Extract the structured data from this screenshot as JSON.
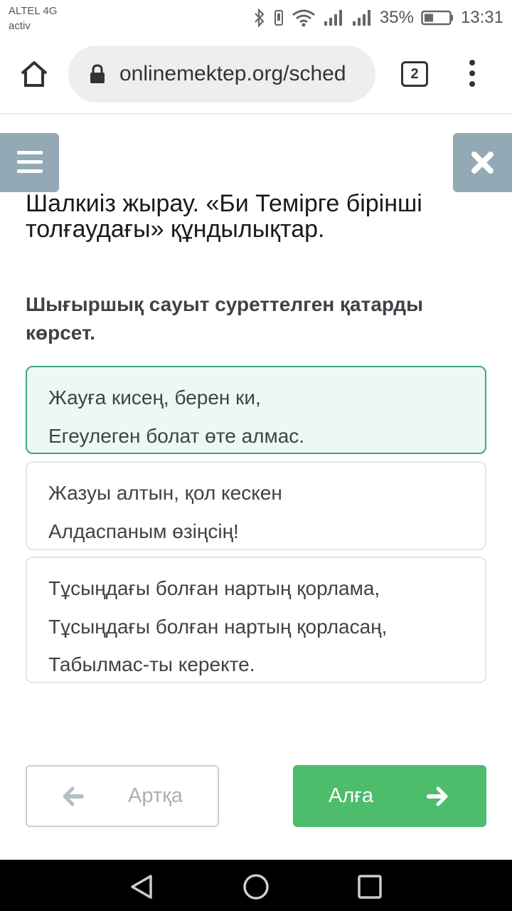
{
  "status_bar": {
    "carrier": "ALTEL 4G",
    "carrier_sub": "activ",
    "battery": "35%",
    "time": "13:31",
    "icons": [
      "bluetooth-icon",
      "vibrate-icon",
      "wifi-icon",
      "signal-icon",
      "signal-icon",
      "battery-icon"
    ]
  },
  "browser": {
    "url": "onlinemektep.org/sched",
    "tab_count": "2",
    "icons": [
      "home-icon",
      "lock-icon",
      "tabs-icon",
      "menu-dots-icon"
    ]
  },
  "lesson": {
    "title_line1": "Шалкиіз жырау. «Би Темірге бірінші",
    "title_line2": "толғаудағы» құндылықтар."
  },
  "question": {
    "text_line1": "Шығыршық сауыт суреттелген қатарды",
    "text_line2": "көрсет."
  },
  "options": [
    {
      "selected": true,
      "lines": [
        "Жауға кисең, берен ки,",
        "Егеулеген болат өте алмас."
      ]
    },
    {
      "selected": false,
      "lines": [
        "Жазуы алтын, қол кескен",
        "Алдаспаным өзіңсің!"
      ]
    },
    {
      "selected": false,
      "lines": [
        "Тұсыңдағы болған нартың қорлама,",
        "Тұсыңдағы болған нартың қорласаң,",
        "Табылмас-ты керекте."
      ]
    }
  ],
  "navigation": {
    "back_label": "Артқа",
    "next_label": "Алға"
  },
  "colors": {
    "accent_green": "#4dbd6c",
    "selected_border": "#3da58a",
    "selected_bg": "#eef8f2",
    "side_button": "#93a9b5"
  }
}
